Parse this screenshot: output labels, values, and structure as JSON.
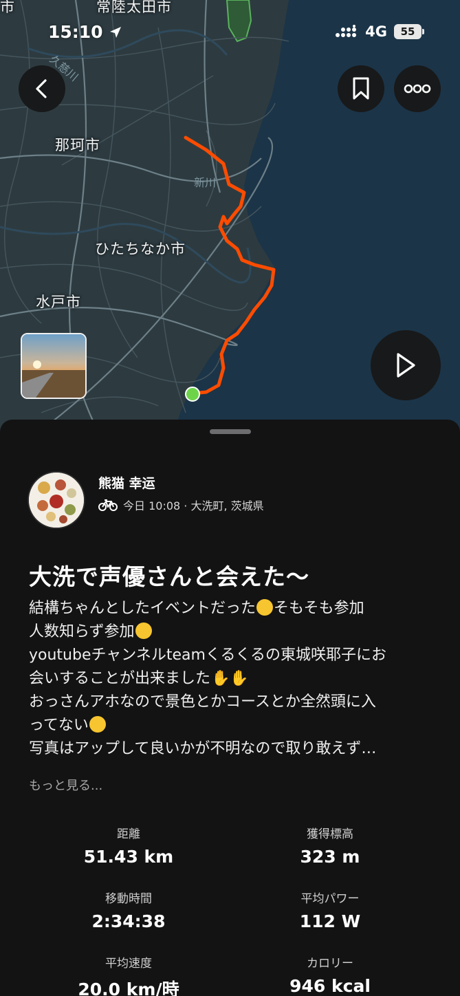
{
  "status_bar": {
    "time": "15:10",
    "network": "4G",
    "battery": "55"
  },
  "map": {
    "labels": {
      "top_city": "常陸太田市",
      "naka_city": "那珂市",
      "hitachinaka_city": "ひたちなか市",
      "mito_city": "水戸市",
      "river_kuji": "久慈川",
      "river_naka": "新川",
      "edge_fragment": "市"
    },
    "route_color": "#fc4c02",
    "start_marker_color": "#6dd44a"
  },
  "activity": {
    "athlete": "熊猫 幸运",
    "meta": "今日 10:08 · 大洗町, 茨城県",
    "title": "大洗で声優さんと会えた〜",
    "description_lines": [
      "結構ちゃんとしたイベントだった",
      "そもそも参加",
      "人数知らず参加",
      "youtubeチャンネルteamくるくるの東城咲耶子にお",
      "会いすることが出来ました",
      "おっさんアホなので景色とかコースとか全然頭に入",
      "ってない",
      "写真はアップして良いかが不明なので取り敢えず…"
    ],
    "more_label": "もっと見る...",
    "stats": [
      {
        "label": "距離",
        "value": "51.43 km"
      },
      {
        "label": "獲得標高",
        "value": "323 m"
      },
      {
        "label": "移動時間",
        "value": "2:34:38"
      },
      {
        "label": "平均パワー",
        "value": "112 W"
      },
      {
        "label": "平均速度",
        "value": "20.0 km/時"
      },
      {
        "label": "カロリー",
        "value": "946 kcal"
      }
    ]
  }
}
